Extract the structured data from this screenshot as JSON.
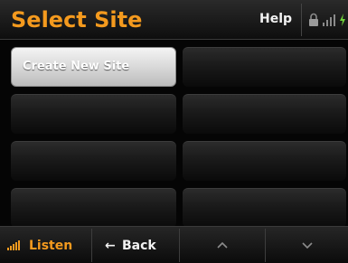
{
  "header": {
    "title": "Select Site",
    "help_label": "Help",
    "status_icons": [
      "lock-icon",
      "signal-icon",
      "battery-icon"
    ]
  },
  "sites": {
    "create_label": "Create New Site",
    "empty_slots": 7
  },
  "footer": {
    "listen_label": "Listen",
    "back_arrow": "←",
    "back_label": "Back",
    "up_icon": "chevron-up-icon",
    "down_icon": "chevron-down-icon"
  },
  "colors": {
    "accent": "#f49a1e",
    "text": "#f2f2f2",
    "background": "#000000"
  }
}
